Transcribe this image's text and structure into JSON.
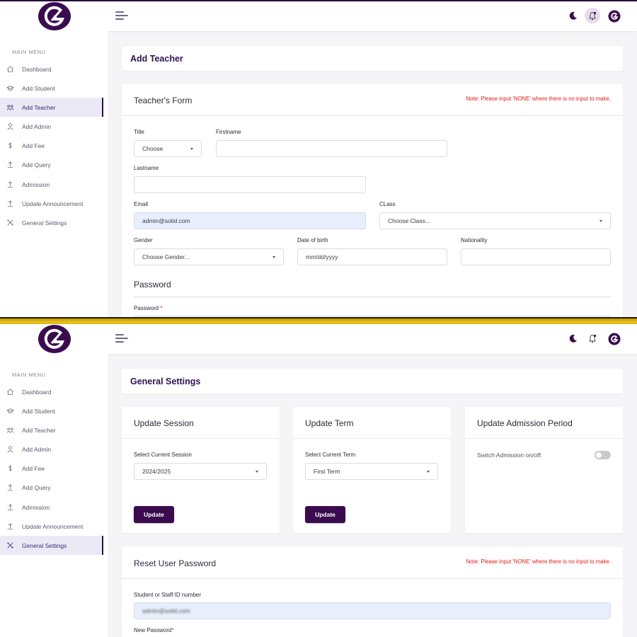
{
  "colors": {
    "brand": "#2e0f47",
    "accent": "#3a0c4f",
    "note": "#e31b1b",
    "active_bg": "#ece9f7",
    "filled_input": "#e8eefc"
  },
  "sidebar": {
    "menu_title": "MAIN MENU",
    "items": [
      {
        "label": "Dashboard",
        "icon": "home-icon"
      },
      {
        "label": "Add Student",
        "icon": "graduation-cap-icon"
      },
      {
        "label": "Add Teacher",
        "icon": "teacher-icon"
      },
      {
        "label": "Add Admin",
        "icon": "user-icon"
      },
      {
        "label": "Add Fee",
        "icon": "dollar-icon"
      },
      {
        "label": "Add Query",
        "icon": "upload-icon"
      },
      {
        "label": "Admission",
        "icon": "upload-icon"
      },
      {
        "label": "Update Announcement",
        "icon": "upload-icon"
      },
      {
        "label": "General Settings",
        "icon": "tools-icon"
      }
    ]
  },
  "screen1": {
    "active_item": "Add Teacher",
    "page_title": "Add Teacher",
    "form_title": "Teacher's Form",
    "note": "Note: Please input 'NONE' where there is no input to make.",
    "fields": {
      "title": {
        "label": "Title",
        "value": "Choose"
      },
      "firstname": {
        "label": "Firstname",
        "value": ""
      },
      "lastname": {
        "label": "Lastname",
        "value": ""
      },
      "email": {
        "label": "Email",
        "value": "admin@solid.com"
      },
      "class": {
        "label": "CLass",
        "value": "Choose Class..."
      },
      "gender": {
        "label": "Gender",
        "value": "Choose Gender..."
      },
      "dob": {
        "label": "Date of birth",
        "value": "mm/dd/yyyy"
      },
      "nationality": {
        "label": "Nationality",
        "value": ""
      }
    },
    "password_section": "Password",
    "password_label": "Password",
    "required_mark": "*"
  },
  "screen2": {
    "active_item": "General Settings",
    "page_title": "General Settings",
    "session": {
      "title": "Update Session",
      "label": "Select Current Session",
      "value": "2024/2025",
      "button": "Update"
    },
    "term": {
      "title": "Update Term",
      "label": "Select Current Term",
      "value": "First Term",
      "button": "Update"
    },
    "admission": {
      "title": "Update Admission Period",
      "label": "Switch Admission on/off:",
      "state": "off"
    },
    "reset": {
      "title": "Reset User Password",
      "note": "Note: Please input 'NONE' where there is no input to make.",
      "id_label": "Student or Staff ID number",
      "id_value": "admin@solid.com",
      "new_password_label": "New Password",
      "required_mark": "*"
    }
  }
}
